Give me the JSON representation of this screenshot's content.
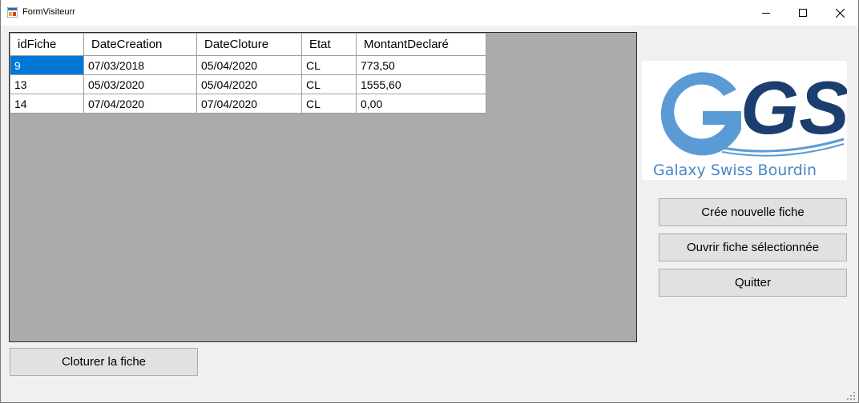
{
  "window": {
    "title": "FormVisiteurr",
    "app_icon": "form-app-icon"
  },
  "grid": {
    "columns": [
      "idFiche",
      "DateCreation",
      "DateCloture",
      "Etat",
      "MontantDeclaré"
    ],
    "rows": [
      [
        "9",
        "07/03/2018",
        "05/04/2020",
        "CL",
        "773,50"
      ],
      [
        "13",
        "05/03/2020",
        "05/04/2020",
        "CL",
        "1555,60"
      ],
      [
        "14",
        "07/04/2020",
        "07/04/2020",
        "CL",
        "0,00"
      ]
    ],
    "selected_cell": "9"
  },
  "logo": {
    "text": "Galaxy Swiss Bourdin",
    "letters": "GSB",
    "colors": {
      "blue_light": "#5b9bd5",
      "navy": "#1b3e6f",
      "text": "#4a86c5"
    }
  },
  "buttons": {
    "new_sheet": "Crée nouvelle fiche",
    "open_selected": "Ouvrir fiche sélectionnée",
    "quit": "Quitter",
    "close_sheet": "Cloturer la fiche"
  },
  "colors": {
    "selection": "#0078d7",
    "grid_background": "#ababab",
    "form_background": "#f0f0f0"
  }
}
